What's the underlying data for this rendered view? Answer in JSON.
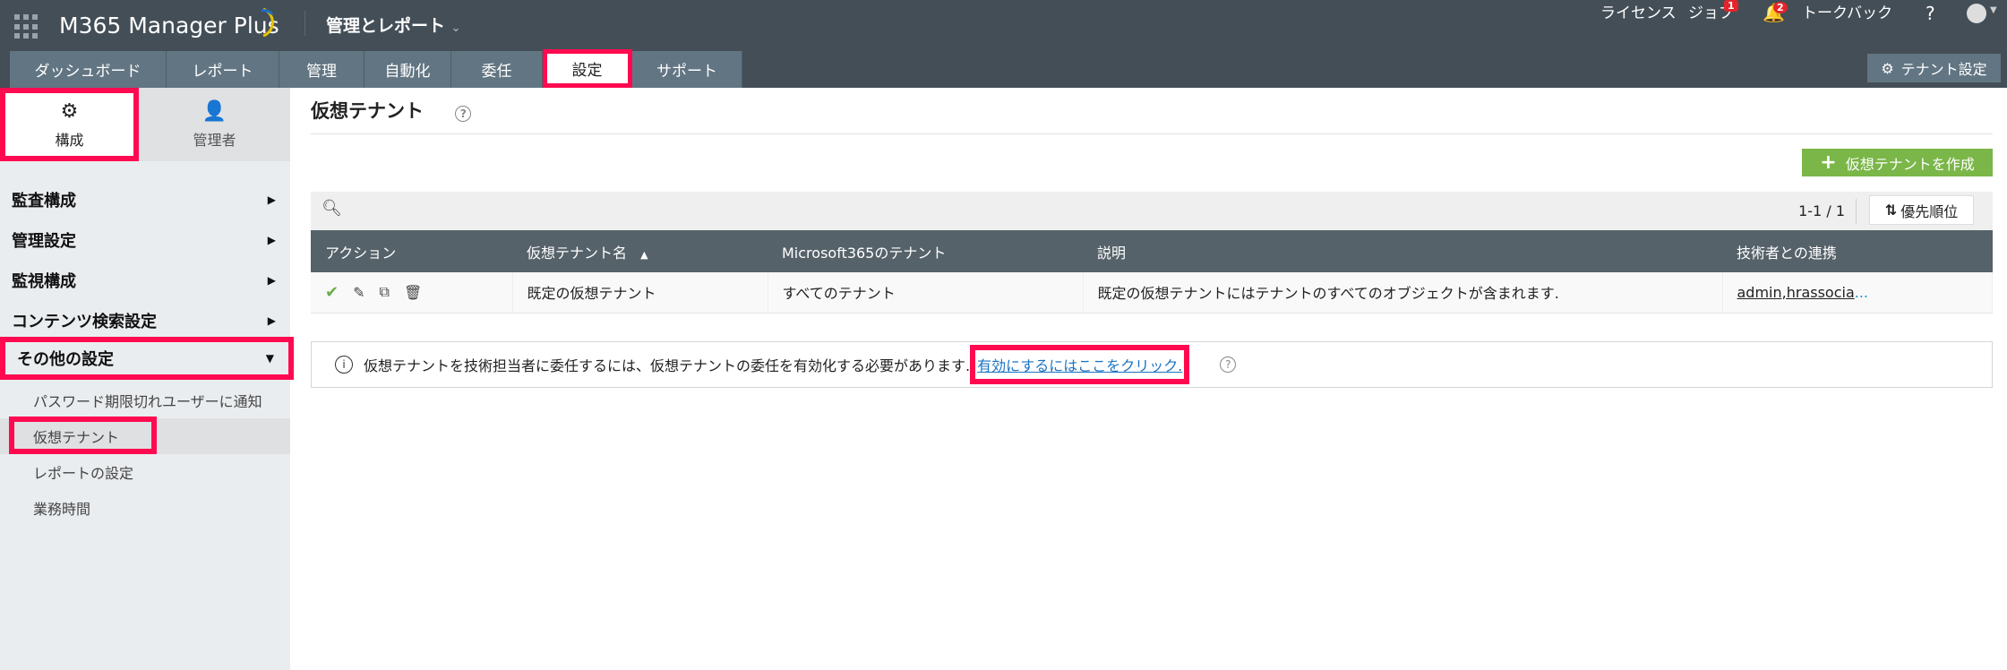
{
  "app": {
    "title": "M365 Manager Plus",
    "module": "管理とレポート"
  },
  "toplinks": {
    "license": "ライセンス",
    "jobs": "ジョブ",
    "jobs_badge": "1",
    "alerts_badge": "2",
    "talkback": "トークバック",
    "help": "?"
  },
  "tabs": [
    "ダッシュボード",
    "レポート",
    "管理",
    "自動化",
    "委任",
    "設定",
    "サポート"
  ],
  "tenant_settings": "テナント設定",
  "sidebar": {
    "tabs": [
      "構成",
      "管理者"
    ],
    "items": [
      "監査構成",
      "管理設定",
      "監視構成",
      "コンテンツ検索設定",
      "その他の設定"
    ],
    "subitems": [
      "パスワード期限切れユーザーに通知",
      "仮想テナント",
      "レポートの設定",
      "業務時間"
    ]
  },
  "main": {
    "title": "仮想テナント",
    "create_button": "仮想テナントを作成",
    "pager": "1-1 / 1",
    "priority_button": "優先順位",
    "columns": [
      "アクション",
      "仮想テナント名",
      "Microsoft365のテナント",
      "説明",
      "技術者との連携"
    ],
    "rows": [
      {
        "name": "既定の仮想テナント",
        "m365": "すべてのテナント",
        "desc": "既定の仮想テナントにはテナントのすべてのオブジェクトが含まれます.",
        "tech": "admin,hrassocia",
        "tech_more": "..."
      }
    ],
    "info_text": "仮想テナントを技術担当者に委任するには、仮想テナントの委任を有効化する必要があります.",
    "info_link": "有効にするにはここをクリック."
  }
}
